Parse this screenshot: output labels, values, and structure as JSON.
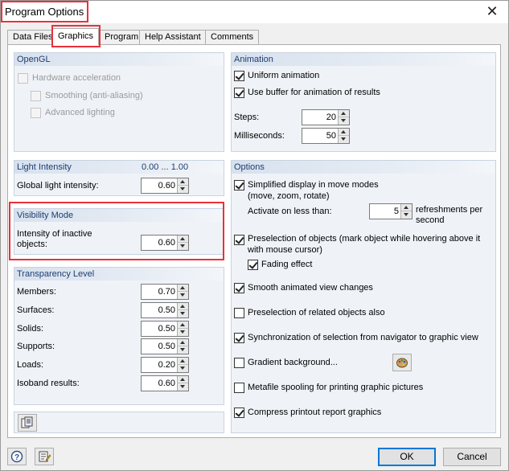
{
  "window": {
    "title": "Program Options",
    "close_glyph": "✕"
  },
  "tabs": [
    {
      "label": "Data Files"
    },
    {
      "label": "Graphics"
    },
    {
      "label": "Program"
    },
    {
      "label": "Help Assistant"
    },
    {
      "label": "Comments"
    }
  ],
  "opengl": {
    "header": "OpenGL",
    "hardware_acceleration": {
      "label": "Hardware acceleration",
      "checked": false
    },
    "smoothing": {
      "label": "Smoothing (anti-aliasing)",
      "checked": false
    },
    "advanced_lighting": {
      "label": "Advanced lighting",
      "checked": false
    }
  },
  "light": {
    "header": "Light Intensity",
    "range": "0.00 ... 1.00",
    "global_label": "Global light intensity:",
    "global_value": "0.60"
  },
  "visibility": {
    "header": "Visibility Mode",
    "label_line1": "Intensity of inactive",
    "label_line2": "objects:",
    "value": "0.60"
  },
  "transparency": {
    "header": "Transparency Level",
    "rows": [
      {
        "label": "Members:",
        "value": "0.70"
      },
      {
        "label": "Surfaces:",
        "value": "0.50"
      },
      {
        "label": "Solids:",
        "value": "0.50"
      },
      {
        "label": "Supports:",
        "value": "0.50"
      },
      {
        "label": "Loads:",
        "value": "0.20"
      },
      {
        "label": "Isoband results:",
        "value": "0.60"
      }
    ]
  },
  "animation": {
    "header": "Animation",
    "uniform": {
      "label": "Uniform animation",
      "checked": true
    },
    "buffer": {
      "label": "Use buffer for animation of results",
      "checked": true
    },
    "steps_label": "Steps:",
    "steps_value": "20",
    "ms_label": "Milliseconds:",
    "ms_value": "50"
  },
  "options": {
    "header": "Options",
    "simplified_line1": "Simplified display in move modes",
    "simplified_line2": "(move, zoom, rotate)",
    "activate_label": "Activate on less than:",
    "activate_value": "5",
    "refresh_line1": "refreshments per",
    "refresh_line2": "second",
    "preselection_line1": "Preselection of objects (mark object while hovering above it",
    "preselection_line2": "with mouse cursor)",
    "fading": "Fading effect",
    "smooth": "Smooth animated view changes",
    "preselection_related": "Preselection of related objects also",
    "sync": "Synchronization of selection from navigator to graphic view",
    "gradient": "Gradient background...",
    "metafile": "Metafile spooling for printing graphic pictures",
    "compress": "Compress printout report graphics",
    "checked": {
      "simplified": true,
      "preselection": true,
      "fading": true,
      "smooth": true,
      "preselection_related": false,
      "sync": true,
      "gradient": false,
      "metafile": false,
      "compress": true
    }
  },
  "footer": {
    "ok": "OK",
    "cancel": "Cancel"
  },
  "colors": {
    "highlight": "#e8313b",
    "group_header_text": "#1d3d70",
    "group_bg": "#eff3f8"
  }
}
